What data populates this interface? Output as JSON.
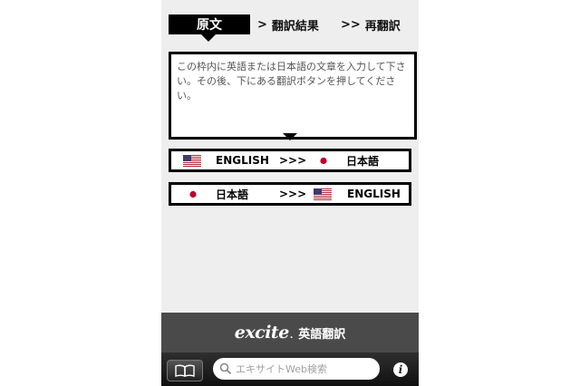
{
  "tabs": {
    "source": "原文",
    "result": "翻訳結果",
    "retranslate": "再翻訳",
    "result_marker": ">",
    "retranslate_marker": ">>"
  },
  "source_box": {
    "placeholder": "この枠内に英語または日本語の文章を入力して下さい。その後、下にある翻訳ボタンを押してください。"
  },
  "buttons": {
    "en_to_ja": {
      "from": "ENGLISH",
      "arrow": ">>>",
      "to": "日本語",
      "from_icon": "us-flag-icon",
      "to_icon": "japan-flag-icon"
    },
    "ja_to_en": {
      "from": "日本語",
      "arrow": ">>>",
      "to": "ENGLISH",
      "from_icon": "japan-flag-icon",
      "to_icon": "us-flag-icon"
    }
  },
  "banner": {
    "brand": "excite",
    "brand_suffix": ".",
    "title": "英語翻訳"
  },
  "toolbar": {
    "search_placeholder": "エキサイトWeb検索",
    "bookmark_icon": "book-icon",
    "info_icon": "info-icon"
  },
  "colors": {
    "tab_active_bg": "#000000",
    "banner_bg": "#4a4a4a",
    "app_bg": "#eeeeee"
  }
}
